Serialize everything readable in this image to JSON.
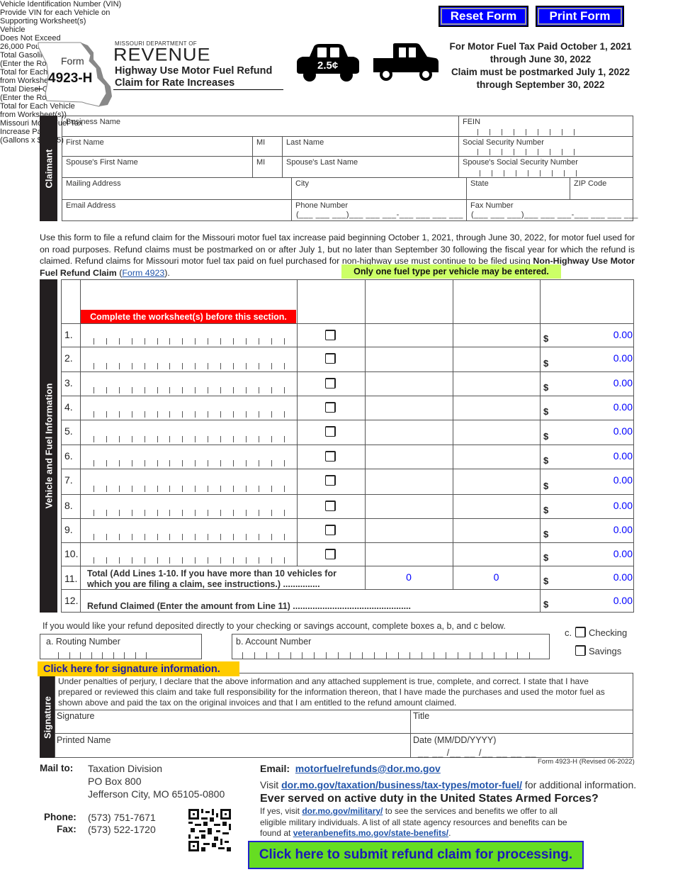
{
  "toolbar": {
    "reset_label": "Reset Form",
    "print_label": "Print Form"
  },
  "header": {
    "form_word": "Form",
    "form_number": "4923-H",
    "dept_small": "MISSOURI DEPARTMENT OF",
    "dept_big": "REVENUE",
    "title_line1": "Highway Use Motor Fuel Refund",
    "title_line2": "Claim for Rate Increases",
    "car_badge": "2.5¢",
    "period_lines": [
      "For Motor Fuel Tax Paid October 1, 2021",
      "through June 30, 2022",
      "Claim must be postmarked July 1, 2022",
      "through September 30, 2022"
    ]
  },
  "claimant": {
    "section_label": "Claimant",
    "fields": {
      "business_name": "Business Name",
      "fein": "FEIN",
      "first_name": "First Name",
      "mi": "MI",
      "last_name": "Last Name",
      "ssn": "Social Security Number",
      "spouse_first_name": "Spouse's First Name",
      "spouse_mi": "MI",
      "spouse_last_name": "Spouse's Last Name",
      "spouse_ssn": "Spouse's Social Security Number",
      "mailing_address": "Mailing Address",
      "city": "City",
      "state": "State",
      "zip": "ZIP Code",
      "email": "Email Address",
      "phone": "Phone Number",
      "fax": "Fax Number"
    },
    "phone_placeholder": "(___ ___ ___)___ ___ ___-___ ___ ___ ___",
    "fax_placeholder": "(___ ___ ___)___ ___ ___-___ ___ ___ ___"
  },
  "intro": {
    "text": "Use this form to file a refund claim for the Missouri motor fuel tax increase paid beginning October 1, 2021, through June 30, 2022, for motor fuel used for on road purposes. Refund claims must be postmarked on or after July 1, but no later than September 30 following the fiscal year for which the refund is claimed. Refund claims for Missouri motor fuel tax paid on fuel purchased for non-highway use must continue to be filed using ",
    "bold_text": "Non-Highway Use Motor Fuel Refund Claim",
    "paren_open": " (",
    "link_text": "Form 4923",
    "paren_close": ")."
  },
  "fuel_note": "Only one fuel type per vehicle may be entered.",
  "vehicle": {
    "section_label": "Vehicle and Fuel Information",
    "headers": {
      "vin": "Vehicle Identification Number (VIN)\nProvide VIN for each Vehicle on\nSupporting Worksheet(s)",
      "weight": "Vehicle\nDoes Not Exceed\n26,000 Pounds",
      "gasoline": "Total Gasoline Gallons\n(Enter the Rounded\nTotal for Each Vehicle\nfrom Worksheet(s))",
      "diesel": "Total Diesel Gallons\n(Enter the Rounded\nTotal for Each Vehicle\nfrom Worksheet(s))",
      "tax": "Missouri Motor Fuel Tax\nIncrease Paid\n(Gallons x $0.025)"
    },
    "worksheet_warning": "Complete the worksheet(s) before this section.",
    "rows": [
      {
        "num": "1.",
        "amount": "0.00"
      },
      {
        "num": "2.",
        "amount": "0.00"
      },
      {
        "num": "3.",
        "amount": "0.00"
      },
      {
        "num": "4.",
        "amount": "0.00"
      },
      {
        "num": "5.",
        "amount": "0.00"
      },
      {
        "num": "6.",
        "amount": "0.00"
      },
      {
        "num": "7.",
        "amount": "0.00"
      },
      {
        "num": "8.",
        "amount": "0.00"
      },
      {
        "num": "9.",
        "amount": "0.00"
      },
      {
        "num": "10.",
        "amount": "0.00"
      }
    ],
    "currency": "$",
    "total": {
      "num": "11.",
      "label_line1": "Total (Add Lines 1-10. If you have more than 10 vehicles for",
      "label_line2": "which you are filing a claim, see instructions.) ...............",
      "gasoline": "0",
      "diesel": "0",
      "amount": "0.00"
    },
    "refund": {
      "num": "12.",
      "label": "Refund Claimed (Enter the amount from Line 11) ................................................",
      "amount": "0.00"
    }
  },
  "deposit": {
    "note": "If you would like your refund deposited directly to your checking or savings account, complete boxes a, b, and c below.",
    "routing_label": "a. Routing Number",
    "account_label": "b. Account Number",
    "c_label": "c.",
    "checking_label": "Checking",
    "savings_label": "Savings"
  },
  "signature": {
    "info_link": "Click here for signature information.",
    "section_label": "Signature",
    "declaration": "Under penalties of perjury, I declare that the above information and any attached supplement is true, complete, and correct. I state that I have prepared or reviewed this claim and take full responsibility for the information thereon, that I have made the purchases and used the motor fuel as shown above and paid the tax on the original invoices and that I am entitled to the refund amount claimed.",
    "signature_label": "Signature",
    "title_label": "Title",
    "printed_name_label": "Printed Name",
    "date_label": "Date (MM/DD/YYYY)",
    "date_placeholder": "__ __ /__ __ /__ __ __ __"
  },
  "footer": {
    "mail_to_label": "Mail to:",
    "address_lines": [
      "Taxation Division",
      "PO Box 800",
      "Jefferson City, MO 65105-0800"
    ],
    "phone_label": "Phone:",
    "phone": "(573) 751-7671",
    "fax_label": "Fax:",
    "fax": "(573) 522-1720",
    "email_label": "Email:",
    "email": "motorfuelrefunds@dor.mo.gov",
    "revision": "Form 4923-H (Revised 06-2022)",
    "visit_prefix": "Visit ",
    "visit_link": "dor.mo.gov/taxation/business/tax-types/motor-fuel/",
    "visit_suffix": " for additional information.",
    "military_heading": "Ever served on active duty in the United States Armed Forces?",
    "military_prefix": "If yes, visit ",
    "military_link": "dor.mo.gov/military/",
    "military_mid": " to see the services and benefits we offer to all eligible military individuals. A list of all state agency resources and benefits can be found at ",
    "veteran_link": "veteranbenefits.mo.gov/state-benefits/",
    "military_end": ".",
    "qr_icon": "qr-code",
    "submit_label": "Click here to submit refund claim for processing."
  },
  "colors": {
    "button_blue": "#0000ff",
    "warning_red": "#ff0000",
    "note_green": "#ccff66",
    "signature_yellow": "#ffcc00",
    "submit_green": "#66dd22",
    "value_blue": "#0000ff"
  }
}
